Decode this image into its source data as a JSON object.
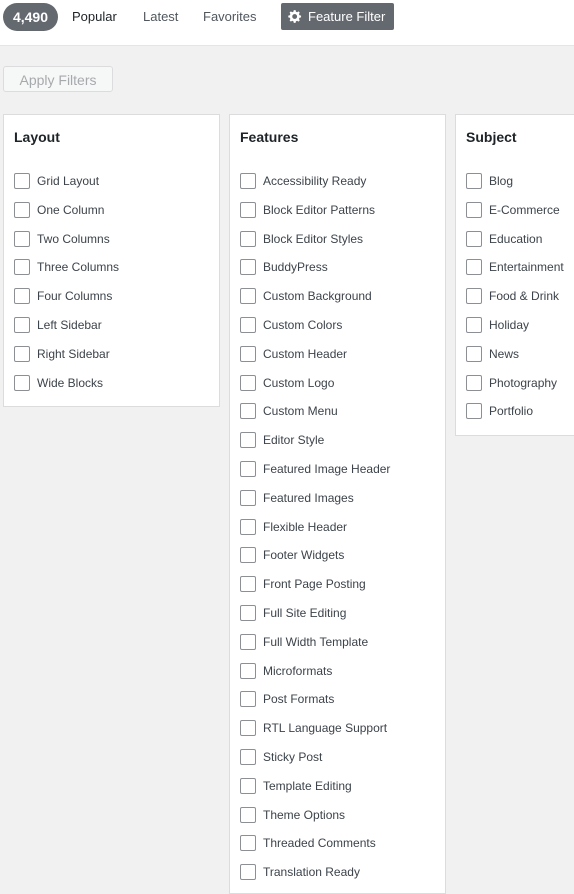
{
  "header": {
    "count": "4,490",
    "tabs": [
      {
        "label": "Popular"
      },
      {
        "label": "Latest"
      },
      {
        "label": "Favorites"
      }
    ],
    "feature_filter": {
      "label": "Feature Filter",
      "icon": "gear-icon"
    }
  },
  "apply_button": {
    "label": "Apply Filters",
    "disabled": true
  },
  "panels": {
    "layout": {
      "title": "Layout",
      "options": [
        "Grid Layout",
        "One Column",
        "Two Columns",
        "Three Columns",
        "Four Columns",
        "Left Sidebar",
        "Right Sidebar",
        "Wide Blocks"
      ]
    },
    "features": {
      "title": "Features",
      "options": [
        "Accessibility Ready",
        "Block Editor Patterns",
        "Block Editor Styles",
        "BuddyPress",
        "Custom Background",
        "Custom Colors",
        "Custom Header",
        "Custom Logo",
        "Custom Menu",
        "Editor Style",
        "Featured Image Header",
        "Featured Images",
        "Flexible Header",
        "Footer Widgets",
        "Front Page Posting",
        "Full Site Editing",
        "Full Width Template",
        "Microformats",
        "Post Formats",
        "RTL Language Support",
        "Sticky Post",
        "Template Editing",
        "Theme Options",
        "Threaded Comments",
        "Translation Ready"
      ]
    },
    "subject": {
      "title": "Subject",
      "options": [
        "Blog",
        "E-Commerce",
        "Education",
        "Entertainment",
        "Food & Drink",
        "Holiday",
        "News",
        "Photography",
        "Portfolio"
      ]
    }
  }
}
